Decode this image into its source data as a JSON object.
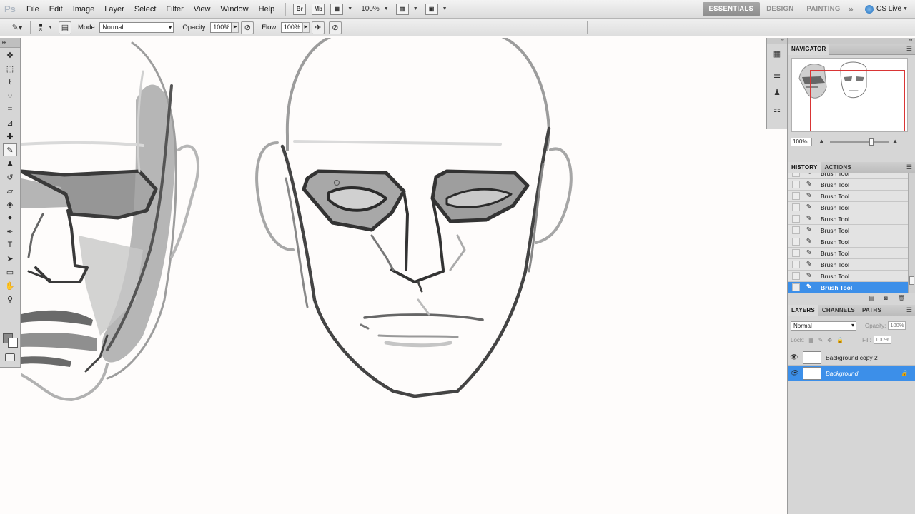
{
  "app": {
    "logo": "Ps"
  },
  "menu": [
    "File",
    "Edit",
    "Image",
    "Layer",
    "Select",
    "Filter",
    "View",
    "Window",
    "Help"
  ],
  "menubar": {
    "bridge_label": "Br",
    "minibridge_label": "Mb",
    "zoom": "100%",
    "workspaces": [
      "ESSENTIALS",
      "DESIGN",
      "PAINTING"
    ],
    "more": "»",
    "cslive": "CS Live"
  },
  "options": {
    "brush_size": "8",
    "mode_label": "Mode:",
    "mode_value": "Normal",
    "opacity_label": "Opacity:",
    "opacity_value": "100%",
    "flow_label": "Flow:",
    "flow_value": "100%"
  },
  "tools": [
    {
      "name": "move-tool",
      "glyph": "✥"
    },
    {
      "name": "marquee-tool",
      "glyph": "⬚"
    },
    {
      "name": "lasso-tool",
      "glyph": "ℓ"
    },
    {
      "name": "quick-select-tool",
      "glyph": "◌"
    },
    {
      "name": "crop-tool",
      "glyph": "⌗"
    },
    {
      "name": "eyedropper-tool",
      "glyph": "⊿"
    },
    {
      "name": "healing-brush-tool",
      "glyph": "✚"
    },
    {
      "name": "brush-tool",
      "glyph": "✎",
      "active": true
    },
    {
      "name": "clone-stamp-tool",
      "glyph": "♟"
    },
    {
      "name": "history-brush-tool",
      "glyph": "↺"
    },
    {
      "name": "eraser-tool",
      "glyph": "▱"
    },
    {
      "name": "paint-bucket-tool",
      "glyph": "◈"
    },
    {
      "name": "dodge-tool",
      "glyph": "●"
    },
    {
      "name": "pen-tool",
      "glyph": "✒"
    },
    {
      "name": "type-tool",
      "glyph": "T"
    },
    {
      "name": "path-select-tool",
      "glyph": "➤"
    },
    {
      "name": "shape-tool",
      "glyph": "▭"
    },
    {
      "name": "hand-tool",
      "glyph": "✋"
    },
    {
      "name": "zoom-tool",
      "glyph": "⚲"
    }
  ],
  "colors": {
    "foreground": "#8a8a8a",
    "background": "#ffffff",
    "selection": "#3c8fe9",
    "nav_box": "#d93535"
  },
  "navigator": {
    "tab": "NAVIGATOR",
    "zoom": "100%"
  },
  "history": {
    "tabs": [
      "HISTORY",
      "ACTIONS"
    ],
    "items": [
      "Brush Tool",
      "Brush Tool",
      "Brush Tool",
      "Brush Tool",
      "Brush Tool",
      "Brush Tool",
      "Brush Tool",
      "Brush Tool",
      "Brush Tool",
      "Brush Tool",
      "Brush Tool"
    ],
    "selected_index": 10
  },
  "layers": {
    "tabs": [
      "LAYERS",
      "CHANNELS",
      "PATHS"
    ],
    "blend_mode": "Normal",
    "opacity_label": "Opacity:",
    "opacity_value": "100%",
    "lock_label": "Lock:",
    "fill_label": "Fill:",
    "fill_value": "100%",
    "items": [
      {
        "name": "Background copy 2",
        "selected": false,
        "locked": false
      },
      {
        "name": "Background",
        "selected": true,
        "locked": true
      }
    ]
  }
}
